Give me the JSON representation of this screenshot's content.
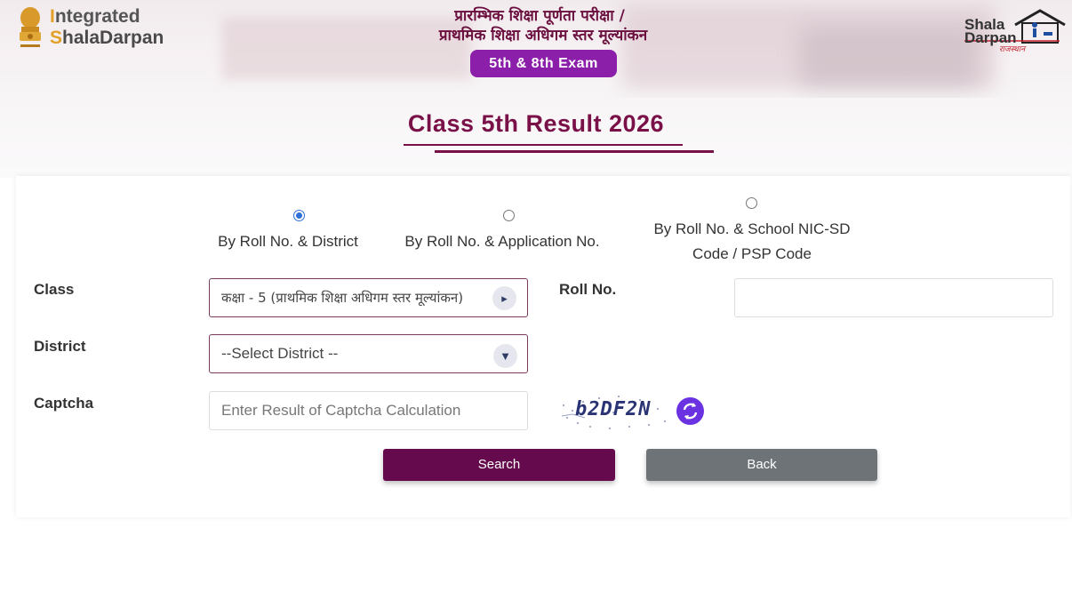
{
  "header": {
    "brand_line1_first": "I",
    "brand_line1_rest": "ntegrated",
    "brand_line2_first": "S",
    "brand_line2_rest": "halaDarpan",
    "title_line1": "प्रारम्भिक शिक्षा पूर्णता परीक्षा /",
    "title_line2": "प्राथमिक शिक्षा अधिगम स्तर मूल्यांकन",
    "exam_badge": "5th & 8th Exam",
    "right_logo_line1": "Shala",
    "right_logo_line2": "Darpan",
    "right_logo_tag": "राजस्थान"
  },
  "page_title": "Class 5th Result 2026",
  "search_options": [
    {
      "label": "By Roll No. & District",
      "selected": true
    },
    {
      "label": "By Roll No. & Application No.",
      "selected": false
    },
    {
      "label_line1": "By Roll No. & School NIC-SD",
      "label_line2": "Code / PSP Code",
      "selected": false
    }
  ],
  "form": {
    "class_label": "Class",
    "class_value": "कक्षा - 5 (प्राथमिक शिक्षा अधिगम स्तर मूल्यांकन)",
    "roll_label": "Roll No.",
    "roll_value": "",
    "district_label": "District",
    "district_value": "--Select District --",
    "captcha_label": "Captcha",
    "captcha_placeholder": "Enter Result of Captcha Calculation",
    "captcha_code": "b2DF2N"
  },
  "buttons": {
    "search": "Search",
    "back": "Back"
  },
  "colors": {
    "primary": "#650a4c",
    "title": "#7a1048",
    "badge": "#8b1fa9",
    "back_button": "#6e7377",
    "refresh_button": "#6a32e0",
    "radio_selected": "#2e6fd8"
  },
  "icons": [
    "emblem-icon",
    "shala-darpan-logo-icon",
    "chevron-down-icon",
    "refresh-icon"
  ]
}
